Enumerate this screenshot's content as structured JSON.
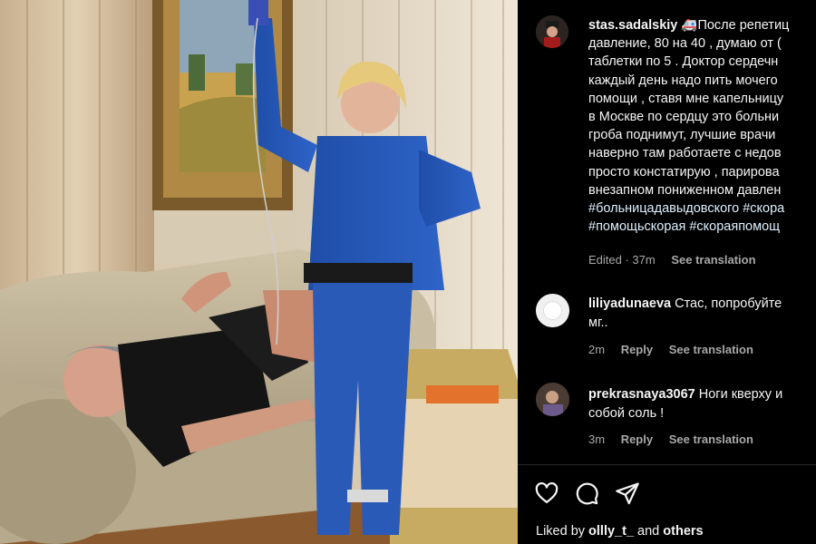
{
  "post": {
    "username": "stas.sadalskiy",
    "caption_lines": [
      "🚑После репетиц",
      "давление, 80 на 40 , думаю от (",
      "таблетки по 5 . Доктор сердечн",
      "каждый день надо пить мочего",
      "помощи , ставя мне капельницу",
      "в Москве по сердцу это больни",
      "гроба поднимут, лучшие врачи",
      "наверно там работаете с недов",
      "просто констатирую , парирова",
      "внезапном пониженном давлен"
    ],
    "hashtag_lines": [
      "#больницадавыдовского #скора",
      "#помощьскорая #скораяпомощ"
    ],
    "edited_label": "Edited · 37m",
    "see_translation": "See translation"
  },
  "comments": [
    {
      "username": "liliyadunaeva",
      "text_line1": "Стас, попробуйте",
      "text_line2": "мг..",
      "time": "2m",
      "reply": "Reply",
      "see_translation": "See translation"
    },
    {
      "username": "prekrasnaya3067",
      "text_line1": "Ноги кверху и",
      "text_line2": "собой соль !",
      "time": "3m",
      "reply": "Reply",
      "see_translation": "See translation"
    }
  ],
  "actions": {
    "icons": [
      "heart-icon",
      "comment-icon",
      "share-icon"
    ]
  },
  "likes": {
    "prefix": "Liked by",
    "user": "ollly_t_",
    "joiner": "and",
    "others": "others"
  },
  "colors": {
    "background": "#000000",
    "text": "#f5f5f5",
    "muted": "#a8a8a8",
    "hashtag": "#e0f1ff"
  }
}
